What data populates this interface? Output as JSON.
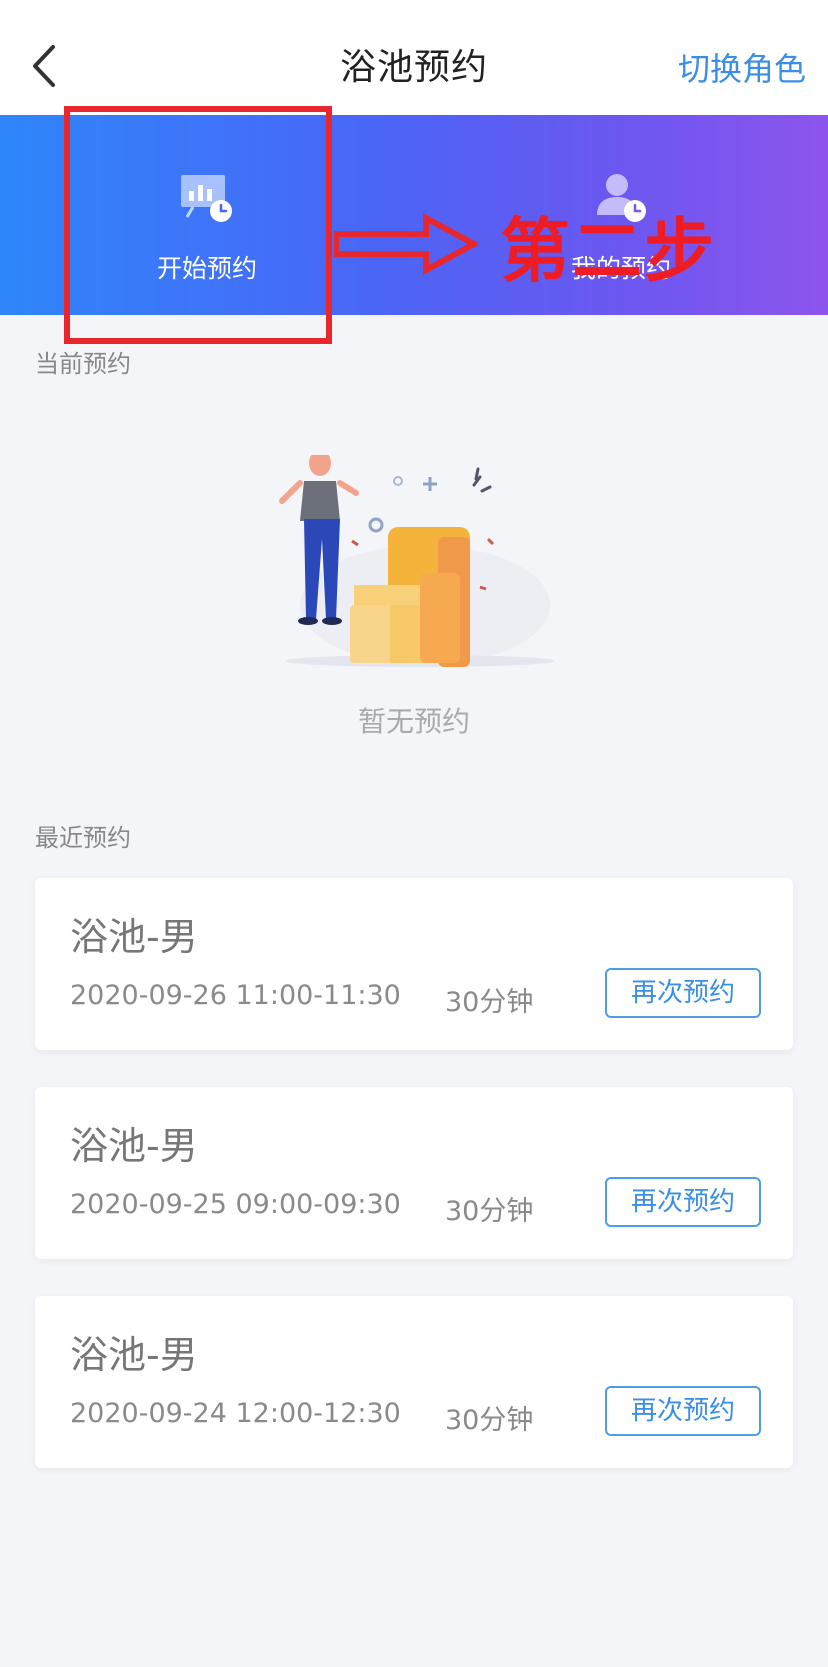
{
  "header": {
    "title": "浴池预约",
    "switch_role": "切换角色",
    "back_icon": "chevron-left-icon"
  },
  "banner": {
    "tabs": [
      {
        "label": "开始预约",
        "icon": "presentation-clock-icon"
      },
      {
        "label": "我的预约",
        "icon": "user-clock-icon"
      }
    ]
  },
  "annotation": {
    "step_text": "第二步",
    "color": "#e8262d"
  },
  "current": {
    "section_label": "当前预约",
    "empty_text": "暂无预约"
  },
  "recent": {
    "section_label": "最近预约",
    "items": [
      {
        "title": "浴池-男",
        "time": "2020-09-26 11:00-11:30",
        "duration": "30分钟",
        "action": "再次预约"
      },
      {
        "title": "浴池-男",
        "time": "2020-09-25 09:00-09:30",
        "duration": "30分钟",
        "action": "再次预约"
      },
      {
        "title": "浴池-男",
        "time": "2020-09-24 12:00-12:30",
        "duration": "30分钟",
        "action": "再次预约"
      }
    ]
  },
  "colors": {
    "accent": "#3a8ee6",
    "banner_start": "#2f86fb",
    "banner_end": "#8d55ee"
  }
}
